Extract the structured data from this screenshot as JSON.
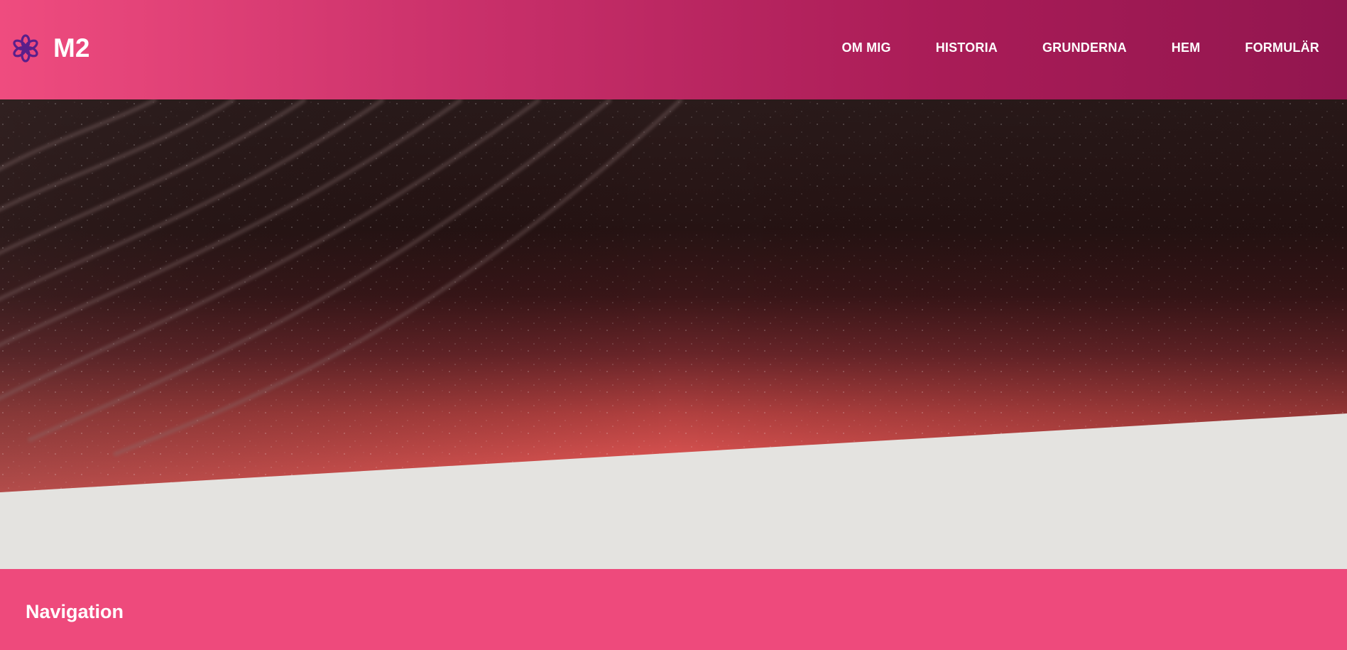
{
  "header": {
    "brand_name": "M2",
    "logo_icon": "flower-icon",
    "logo_color": "#5a1f8a",
    "gradient": [
      "#ef4c7f",
      "#c9306a",
      "#a91c57",
      "#92164f"
    ]
  },
  "nav": {
    "items": [
      {
        "label": "OM MIG"
      },
      {
        "label": "HISTORIA"
      },
      {
        "label": "GRUNDERNA"
      },
      {
        "label": "HEM"
      },
      {
        "label": "FORMULÄR"
      }
    ]
  },
  "hero": {
    "image": "sand-dunes-photo",
    "colors": {
      "top": "#2a1414",
      "bottom": "#f05a5a"
    }
  },
  "footer": {
    "heading": "Navigation",
    "background": "#ee4a7c"
  }
}
